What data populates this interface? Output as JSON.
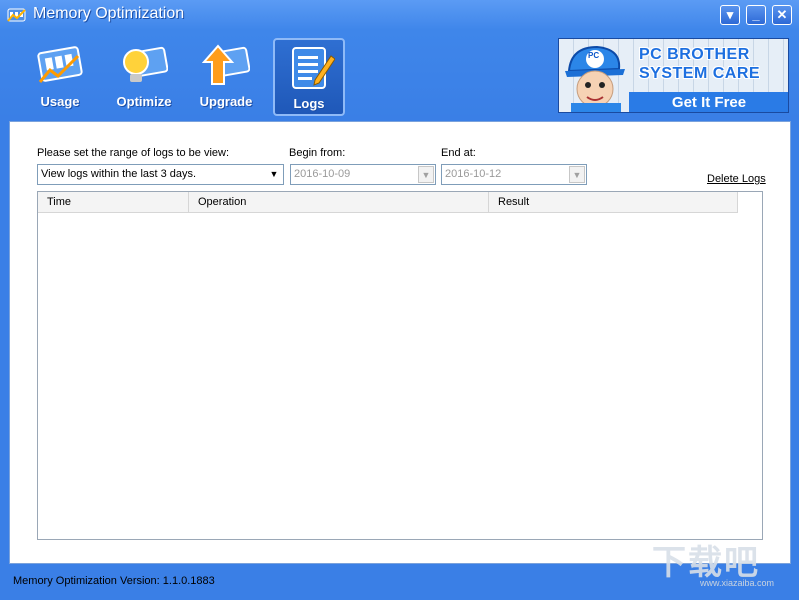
{
  "window": {
    "title": "Memory Optimization",
    "controls": [
      "▾",
      "_",
      "✕"
    ]
  },
  "toolbar": {
    "items": [
      {
        "label": "Usage",
        "icon": "usage-chart-icon",
        "active": false
      },
      {
        "label": "Optimize",
        "icon": "lightbulb-icon",
        "active": false
      },
      {
        "label": "Upgrade",
        "icon": "upgrade-arrow-icon",
        "active": false
      },
      {
        "label": "Logs",
        "icon": "notepad-pencil-icon",
        "active": true
      }
    ]
  },
  "banner": {
    "line1": "PC BROTHER",
    "line2": "SYSTEM CARE",
    "cta": "Get It Free",
    "mascot_badge": "PC"
  },
  "logs": {
    "range_label": "Please set the range of logs to be view:",
    "range_value": "View logs within the last 3 days.",
    "begin_label": "Begin from:",
    "begin_value": "2016-10-09",
    "end_label": "End at:",
    "end_value": "2016-10-12",
    "delete_label": "Delete Logs",
    "columns": [
      "Time",
      "Operation",
      "Result"
    ],
    "rows": []
  },
  "status": {
    "version_text": "Memory Optimization Version: 1.1.0.1883"
  },
  "watermark": {
    "text": "下载吧",
    "sub": "www.xiazaiba.com"
  },
  "colors": {
    "frame": "#3f86ea",
    "accent": "#1d6fe0"
  }
}
